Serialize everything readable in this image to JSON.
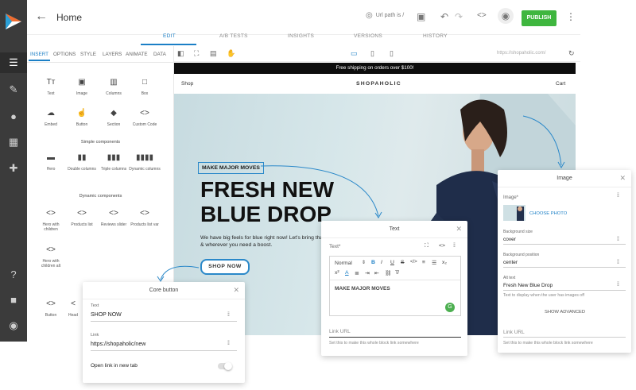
{
  "topbar": {
    "back_icon": "arrow-left",
    "title": "Home",
    "url_label": "Url path is /",
    "publish_label": "PUBLISH"
  },
  "tabs": [
    "EDIT",
    "A/B TESTS",
    "INSIGHTS",
    "VERSIONS",
    "HISTORY"
  ],
  "panel": {
    "tabs": [
      "INSERT",
      "OPTIONS",
      "STYLE",
      "LAYERS",
      "ANIMATE",
      "DATA"
    ],
    "basic_items": [
      "Text",
      "Image",
      "Columns",
      "Box",
      "Embed",
      "Button",
      "Section",
      "Custom Code"
    ],
    "simple_title": "Simple components",
    "simple_items": [
      "Hero",
      "Double columns",
      "Triple columns",
      "Dynamic columns"
    ],
    "dynamic_title": "Dynamic components",
    "dynamic_items": [
      "Hero with children",
      "Products list",
      "Reviews slider",
      "Products list var",
      "Hero with children alt"
    ],
    "bottom_items": [
      "Button",
      "Head"
    ]
  },
  "canvas": {
    "url": "https://shopaholic.com/"
  },
  "site": {
    "banner": "Free shipping on orders over $100!",
    "nav_shop": "Shop",
    "brand": "SHOPAHOLIC",
    "nav_cart": "Cart",
    "badge": "MAKE MAJOR MOVES",
    "headline_1": "FRESH NEW",
    "headline_2": "BLUE DROP",
    "subtext": "We have big feels for blue right now! Let's bring that street & wherever you need a boost.",
    "cta": "SHOP NOW"
  },
  "core_button": {
    "title": "Core button",
    "text_label": "Text",
    "text_value": "SHOP NOW",
    "link_label": "Link",
    "link_value": "https://shopaholic/new",
    "toggle_label": "Open link in new tab"
  },
  "text_editor": {
    "title": "Text",
    "field_label": "Text*",
    "format": "Normal",
    "content": "MAKE MAJOR MOVES",
    "link_placeholder": "Link URL",
    "link_helper": "Set this to make this whole block link somewhere"
  },
  "image_panel": {
    "title": "Image",
    "image_label": "Image*",
    "choose_label": "CHOOSE PHOTO",
    "bg_size_label": "Background size",
    "bg_size_value": "cover",
    "bg_pos_label": "Background position",
    "bg_pos_value": "center",
    "alt_label": "Alt text",
    "alt_value": "Fresh New Blue Drop",
    "alt_helper": "Text to display when the user has images off",
    "advanced": "SHOW ADVANCED",
    "link_placeholder": "Link URL",
    "link_helper": "Set this to make this whole block link somewhere"
  },
  "colors": {
    "accent": "#1b7fc6",
    "publish": "#3fb63f",
    "nav": "#3b3b3b",
    "banner": "#0d0d0d"
  }
}
